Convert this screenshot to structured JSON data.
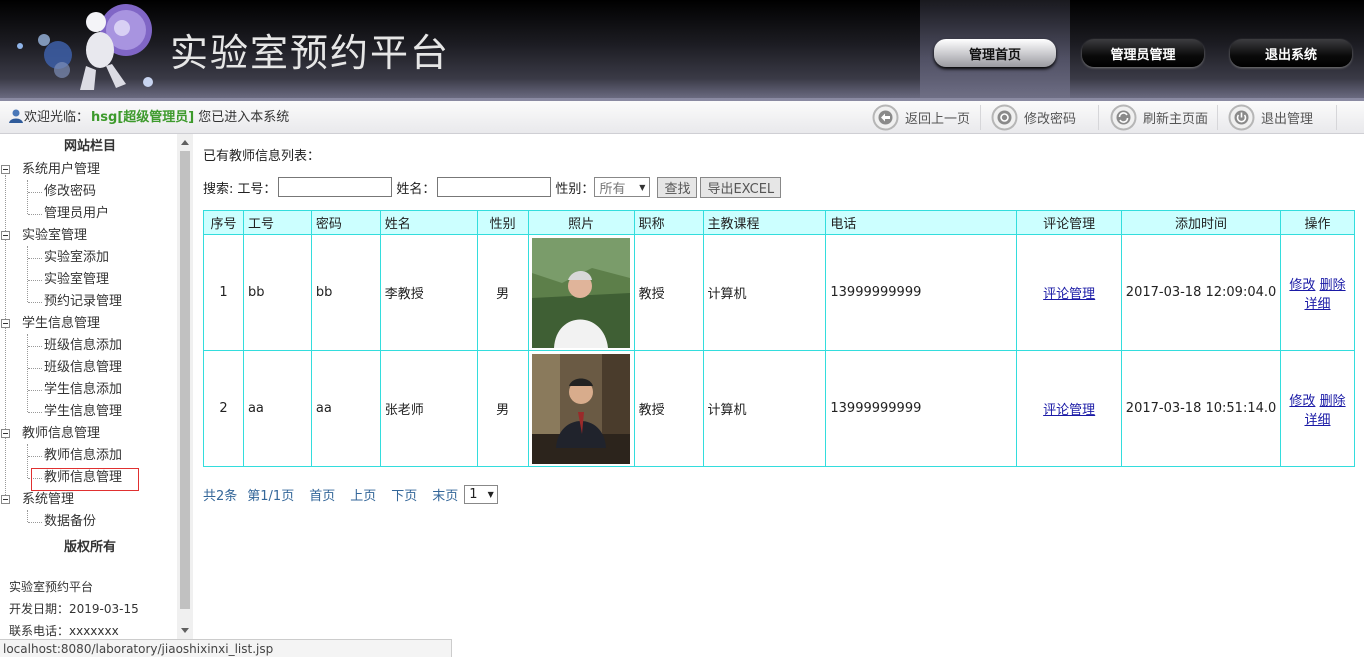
{
  "header": {
    "title": "实验室预约平台",
    "nav": [
      "管理首页",
      "管理员管理",
      "退出系统"
    ]
  },
  "toolbar": {
    "welcome_prefix": "欢迎光临：",
    "user": "hsg[超级管理员]",
    "welcome_suffix": "您已进入本系统",
    "actions": [
      "返回上一页",
      "修改密码",
      "刷新主页面",
      "退出管理"
    ]
  },
  "sidebar": {
    "title": "网站栏目",
    "groups": [
      {
        "label": "系统用户管理",
        "items": [
          "修改密码",
          "管理员用户"
        ]
      },
      {
        "label": "实验室管理",
        "items": [
          "实验室添加",
          "实验室管理",
          "预约记录管理"
        ]
      },
      {
        "label": "学生信息管理",
        "items": [
          "班级信息添加",
          "班级信息管理",
          "学生信息添加",
          "学生信息管理"
        ]
      },
      {
        "label": "教师信息管理",
        "items": [
          "教师信息添加",
          "教师信息管理"
        ]
      },
      {
        "label": "系统管理",
        "items": [
          "数据备份"
        ]
      }
    ],
    "selected": "教师信息管理",
    "copyright": "版权所有",
    "info": [
      "实验室预约平台",
      "开发日期：2019-03-15",
      "联系电话：xxxxxxx"
    ]
  },
  "main": {
    "list_title": "已有教师信息列表：",
    "search": {
      "label": "搜索:",
      "id_label": "工号：",
      "name_label": "姓名：",
      "gender_label": "性别：",
      "gender_value": "所有",
      "find_button": "查找",
      "export_button": "导出EXCEL"
    },
    "table": {
      "headers": [
        "序号",
        "工号",
        "密码",
        "姓名",
        "性别",
        "照片",
        "职称",
        "主教课程",
        "电话",
        "评论管理",
        "添加时间",
        "操作"
      ],
      "rows": [
        {
          "no": "1",
          "id": "bb",
          "pwd": "bb",
          "name": "李教授",
          "gender": "男",
          "title": "教授",
          "course": "计算机",
          "phone": "13999999999",
          "comment": "评论管理",
          "time": "2017-03-18 12:09:04.0",
          "edit": "修改",
          "del": "删除",
          "detail": "详细"
        },
        {
          "no": "2",
          "id": "aa",
          "pwd": "aa",
          "name": "张老师",
          "gender": "男",
          "title": "教授",
          "course": "计算机",
          "phone": "13999999999",
          "comment": "评论管理",
          "time": "2017-03-18 10:51:14.0",
          "edit": "修改",
          "del": "删除",
          "detail": "详细"
        }
      ]
    },
    "pager": {
      "total": "共2条",
      "page": "第1/1页",
      "first": "首页",
      "prev": "上页",
      "next": "下页",
      "last": "末页",
      "current": "1"
    }
  },
  "status_url": "localhost:8080/laboratory/jiaoshixinxi_list.jsp"
}
